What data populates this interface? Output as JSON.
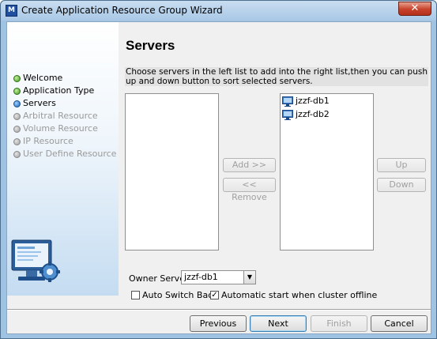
{
  "window": {
    "title": "Create Application Resource Group Wizard",
    "close_glyph": "✕"
  },
  "sidebar": {
    "items": [
      {
        "label": "Welcome",
        "state": "done"
      },
      {
        "label": "Application Type",
        "state": "done"
      },
      {
        "label": "Servers",
        "state": "current"
      },
      {
        "label": "Arbitral Resource",
        "state": "pending"
      },
      {
        "label": "Volume Resource",
        "state": "pending"
      },
      {
        "label": "IP Resource",
        "state": "pending"
      },
      {
        "label": "User Define Resource",
        "state": "pending"
      }
    ],
    "illustration_icon": "computer-settings-icon"
  },
  "main": {
    "heading": "Servers",
    "instructions": "Choose servers in the left list to add into the right list,then you can push up and down button to sort selected servers.",
    "available_servers": [],
    "selected_servers": [
      "jzzf-db1",
      "jzzf-db2"
    ],
    "server_icon": "server-computer-icon",
    "add_label": "Add >>",
    "remove_label": "<< Remove",
    "up_label": "Up",
    "down_label": "Down",
    "owner_label": "Owner Server",
    "owner_value": "jzzf-db1",
    "auto_switch_back_label": "Auto Switch Back",
    "auto_switch_back_checked": false,
    "auto_start_label": "Automatic start when cluster offline",
    "auto_start_checked": true
  },
  "footer": {
    "previous_label": "Previous",
    "next_label": "Next",
    "finish_label": "Finish",
    "cancel_label": "Cancel"
  },
  "colors": {
    "done": "#3d9a1d",
    "current": "#1d64b8",
    "pending": "#9a9a9a",
    "frame": "#9fc3e2"
  }
}
